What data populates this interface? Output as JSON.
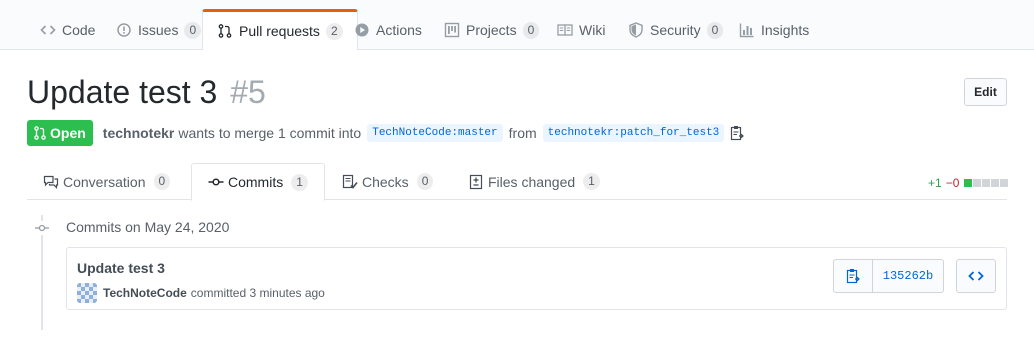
{
  "repo_nav": {
    "tabs": [
      {
        "label": "Code",
        "icon": "code-icon",
        "counter": null
      },
      {
        "label": "Issues",
        "icon": "issue-icon",
        "counter": "0"
      },
      {
        "label": "Pull requests",
        "icon": "pull-request-icon",
        "counter": "2"
      },
      {
        "label": "Actions",
        "icon": "play-icon",
        "counter": null
      },
      {
        "label": "Projects",
        "icon": "project-icon",
        "counter": "0"
      },
      {
        "label": "Wiki",
        "icon": "book-icon",
        "counter": null
      },
      {
        "label": "Security",
        "icon": "shield-icon",
        "counter": "0"
      },
      {
        "label": "Insights",
        "icon": "graph-icon",
        "counter": null
      }
    ],
    "selected": "Pull requests",
    "accent_color": "#e36209"
  },
  "pr": {
    "title": "Update test 3",
    "number": "#5",
    "edit_label": "Edit",
    "state": "Open",
    "state_color": "#2cbe4e",
    "author": "technotekr",
    "merge_text": "wants to merge 1 commit into",
    "base_branch": "TechNoteCode:master",
    "from_text": "from",
    "head_branch": "technotekr:patch_for_test3"
  },
  "pr_tabs": [
    {
      "label": "Conversation",
      "icon": "comment-discussion-icon",
      "counter": "0"
    },
    {
      "label": "Commits",
      "icon": "git-commit-icon",
      "counter": "1"
    },
    {
      "label": "Checks",
      "icon": "checklist-icon",
      "counter": "0"
    },
    {
      "label": "Files changed",
      "icon": "diff-icon",
      "counter": "1"
    }
  ],
  "diffstat": {
    "additions": "+1",
    "deletions": "−0",
    "blocks": 5,
    "green_blocks": 1
  },
  "commits": {
    "date_heading": "Commits on May 24, 2020",
    "items": [
      {
        "title": "Update test 3",
        "author": "TechNoteCode",
        "committed_text": "committed 3 minutes ago",
        "sha": "135262b"
      }
    ]
  }
}
